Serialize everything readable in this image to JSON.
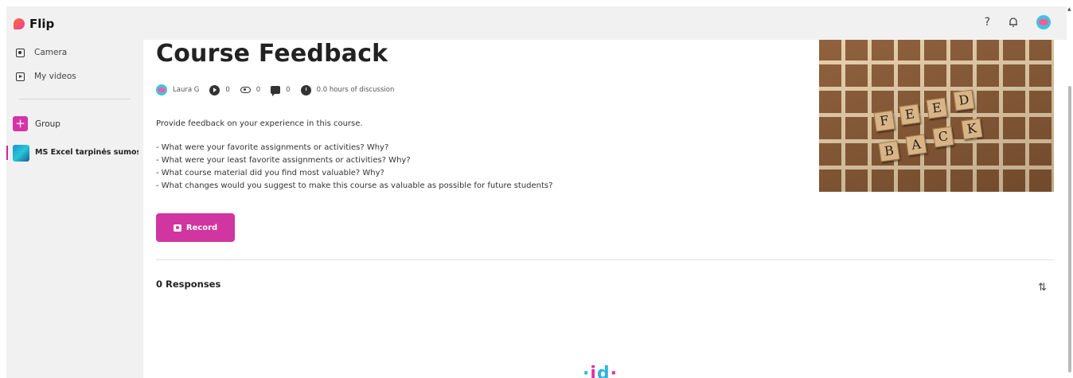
{
  "app": {
    "name": "Flip",
    "help_label": "?"
  },
  "sidebar": {
    "items": [
      {
        "label": "Camera",
        "icon": "camera-icon"
      },
      {
        "label": "My videos",
        "icon": "video-icon"
      }
    ],
    "group_button_label": "Group",
    "groups": [
      {
        "name": "MS Excel tarpinės sumos ...",
        "active": true
      }
    ]
  },
  "topic": {
    "title": "Course Feedback",
    "author": "Laura G",
    "stats": {
      "videos": "0",
      "views": "0",
      "comments": "0",
      "discussion": "0.0 hours of discussion"
    },
    "description": [
      "Provide feedback on your experience in this course.",
      "",
      "- What were your favorite assignments or activities? Why?",
      "- What were your least favorite assignments or activities? Why?",
      "- What course material did you find most valuable? Why?",
      "- What changes would you suggest to make this course as valuable as possible for future students?"
    ],
    "record_label": "Record",
    "responses_label": "0 Responses",
    "sort_symbol": "⇅",
    "hero_tiles": [
      "F",
      "E",
      "E",
      "D",
      "B",
      "A",
      "C",
      "K"
    ]
  },
  "colors": {
    "accent": "#d1359f",
    "sidebar_bg": "#f1f1f1"
  }
}
